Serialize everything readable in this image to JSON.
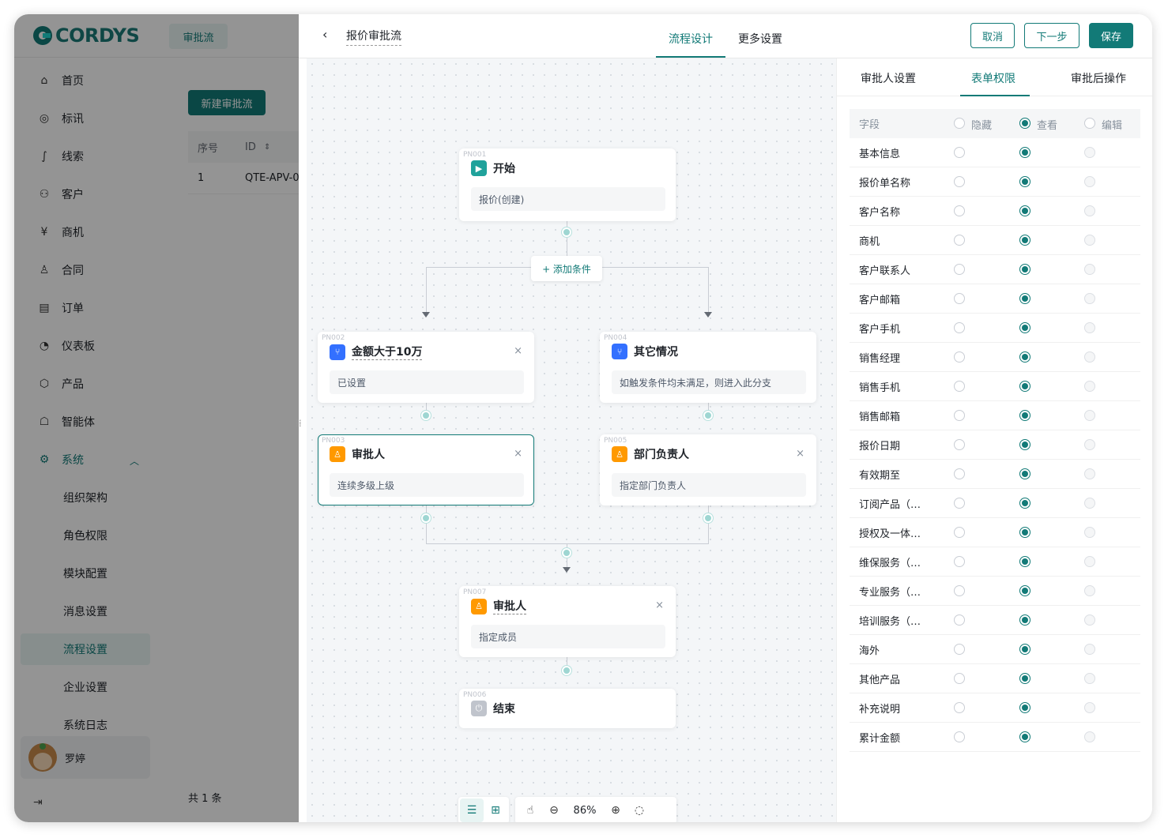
{
  "brand": {
    "name": "CORDYS",
    "color": "#127a77"
  },
  "top_tab": "审批流",
  "sidebar": {
    "items": [
      {
        "label": "首页",
        "icon": "home-icon",
        "glyph": "⌂"
      },
      {
        "label": "标讯",
        "icon": "target-icon",
        "glyph": "◎"
      },
      {
        "label": "线索",
        "icon": "clue-icon",
        "glyph": "∫"
      },
      {
        "label": "客户",
        "icon": "customer-icon",
        "glyph": "⚇"
      },
      {
        "label": "商机",
        "icon": "yen-icon",
        "glyph": "¥"
      },
      {
        "label": "合同",
        "icon": "stamp-icon",
        "glyph": "♙"
      },
      {
        "label": "订单",
        "icon": "order-icon",
        "glyph": "▤"
      },
      {
        "label": "仪表板",
        "icon": "dashboard-icon",
        "glyph": "◔"
      },
      {
        "label": "产品",
        "icon": "product-box-icon",
        "glyph": "⬡"
      },
      {
        "label": "智能体",
        "icon": "robot-icon",
        "glyph": "☖"
      },
      {
        "label": "系统",
        "icon": "gear-icon",
        "glyph": "⚙"
      }
    ],
    "sub_items": [
      "组织架构",
      "角色权限",
      "模块配置",
      "消息设置",
      "流程设置",
      "企业设置",
      "系统日志"
    ],
    "active_sub": "流程设置",
    "user_name": "罗婷"
  },
  "list": {
    "new_button": "新建审批流",
    "col_index": "序号",
    "col_id": "ID",
    "row_index": "1",
    "row_id": "QTE-APV-0",
    "total": "共 1 条"
  },
  "drawer": {
    "title": "报价审批流",
    "tabs": [
      "流程设计",
      "更多设置"
    ],
    "buttons": {
      "cancel": "取消",
      "next": "下一步",
      "save": "保存"
    }
  },
  "flow": {
    "add_condition": "+ 添加条件",
    "nodes": {
      "start": {
        "id": "PN001",
        "title": "开始",
        "body": "报价(创建)"
      },
      "cond1": {
        "id": "PN002",
        "title": "金额大于10万",
        "body": "已设置"
      },
      "cond2": {
        "id": "PN004",
        "title": "其它情况",
        "body": "如触发条件均未满足，则进入此分支"
      },
      "appr1": {
        "id": "PN003",
        "title": "审批人",
        "body": "连续多级上级"
      },
      "dept": {
        "id": "PN005",
        "title": "部门负责人",
        "body": "指定部门负责人"
      },
      "appr2": {
        "id": "PN007",
        "title": "审批人",
        "body": "指定成员"
      },
      "end": {
        "id": "PN006",
        "title": "结束"
      }
    },
    "zoom": "86%"
  },
  "panel": {
    "tabs": [
      "审批人设置",
      "表单权限",
      "审批后操作"
    ],
    "head": {
      "field": "字段",
      "hide": "隐藏",
      "view": "查看",
      "edit": "编辑"
    },
    "rows": [
      "基本信息",
      "报价单名称",
      "客户名称",
      "商机",
      "客户联系人",
      "客户邮箱",
      "客户手机",
      "销售经理",
      "销售手机",
      "销售邮箱",
      "报价日期",
      "有效期至",
      "订阅产品（…",
      "授权及一体…",
      "维保服务（…",
      "专业服务（…",
      "培训服务（…",
      "海外",
      "其他产品",
      "补充说明",
      "累计金额"
    ],
    "selected": "查看"
  }
}
